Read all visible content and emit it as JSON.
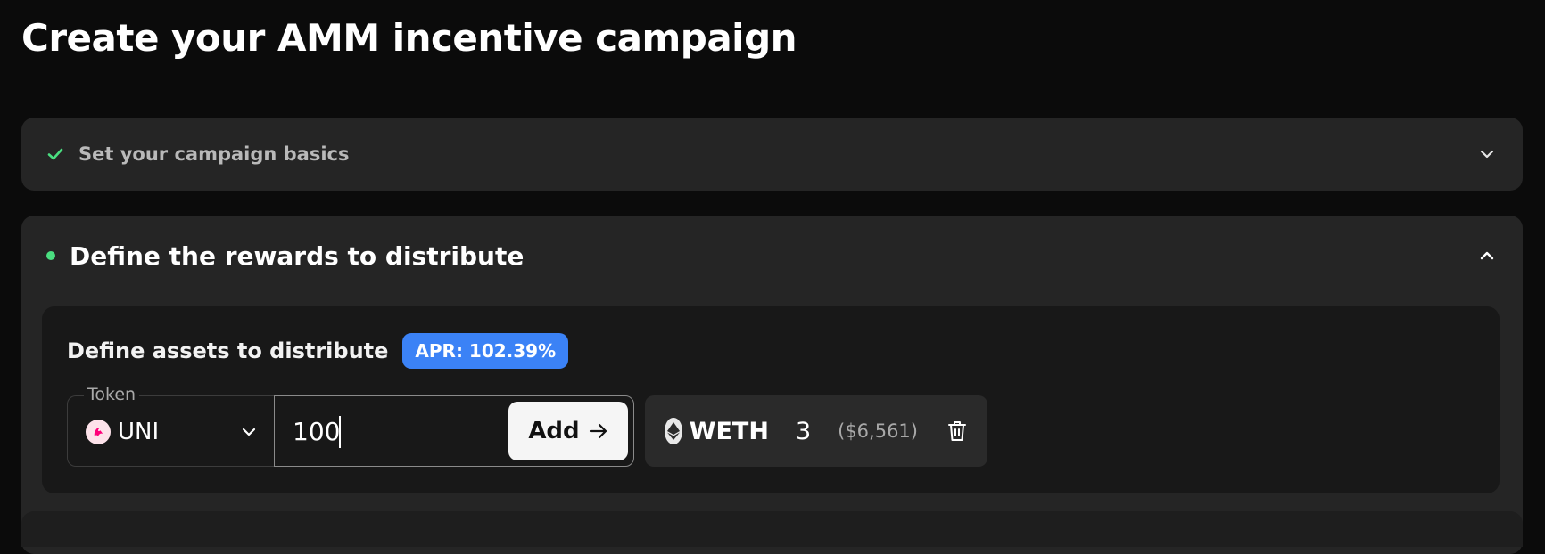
{
  "page": {
    "title": "Create your AMM incentive campaign"
  },
  "steps": {
    "basics": {
      "label": "Set your campaign basics",
      "status": "complete"
    },
    "rewards": {
      "title": "Define the rewards to distribute",
      "status": "active"
    }
  },
  "assets": {
    "title": "Define assets to distribute",
    "apr_badge": "APR: 102.39%",
    "token_field_label": "Token",
    "selected_token": "UNI",
    "amount_value": "100",
    "add_label": "Add",
    "added": [
      {
        "symbol": "WETH",
        "amount": "3",
        "usd": "($6,561)"
      }
    ]
  },
  "colors": {
    "background": "#0b0b0b",
    "card": "#252525",
    "inner_card": "#181818",
    "accent_green": "#4ade80",
    "apr_blue": "#3b82f6"
  },
  "icons": [
    "check-icon",
    "chevron-down-icon",
    "chevron-up-icon",
    "uni-token-icon",
    "eth-token-icon",
    "arrow-right-icon",
    "trash-icon"
  ]
}
